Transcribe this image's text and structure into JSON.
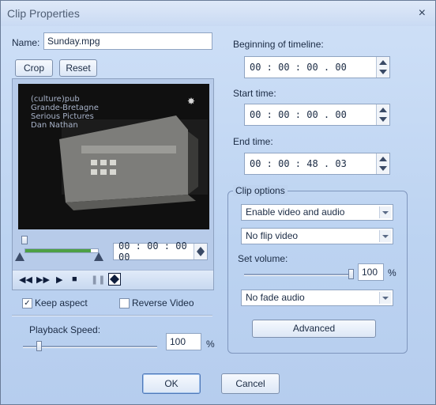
{
  "window": {
    "title": "Clip Properties",
    "close_glyph": "×"
  },
  "name_field": {
    "label": "Name:",
    "value": "Sunday.mpg"
  },
  "buttons": {
    "crop": "Crop",
    "reset": "Reset",
    "advanced": "Advanced",
    "ok": "OK",
    "cancel": "Cancel"
  },
  "preview": {
    "overlay_lines": [
      "(culture)pub",
      "Grande-Bretagne",
      "Serious Pictures",
      "Dan Nathan"
    ],
    "position_time": "00 : 00 : 00 . 00",
    "range_fill_fraction": 0.9
  },
  "controls": {
    "icons": [
      "rewind-icon",
      "fast-forward-icon",
      "play-icon",
      "stop-icon",
      "pause-icon",
      "fit-icon"
    ]
  },
  "options": {
    "keep_aspect_label": "Keep aspect",
    "keep_aspect_checked": true,
    "reverse_video_label": "Reverse Video",
    "reverse_video_checked": false
  },
  "playback": {
    "label": "Playback Speed:",
    "value": "100",
    "unit": "%",
    "slider_fraction": 0.1
  },
  "timeline": {
    "beginning_label": "Beginning of timeline:",
    "beginning_value": "00 : 00 : 00 . 00",
    "start_label": "Start time:",
    "start_value": "00 : 00 : 00 . 00",
    "end_label": "End time:",
    "end_value": "00 : 00 : 48 . 03"
  },
  "clip_options": {
    "title": "Clip options",
    "video_audio": "Enable video and audio",
    "flip": "No flip video",
    "volume_label": "Set volume:",
    "volume_value": "100",
    "volume_unit": "%",
    "volume_fraction": 1.0,
    "fade": "No fade audio"
  },
  "colors": {
    "window_bg": "#bed3ef",
    "accent": "#2b5fb8"
  }
}
